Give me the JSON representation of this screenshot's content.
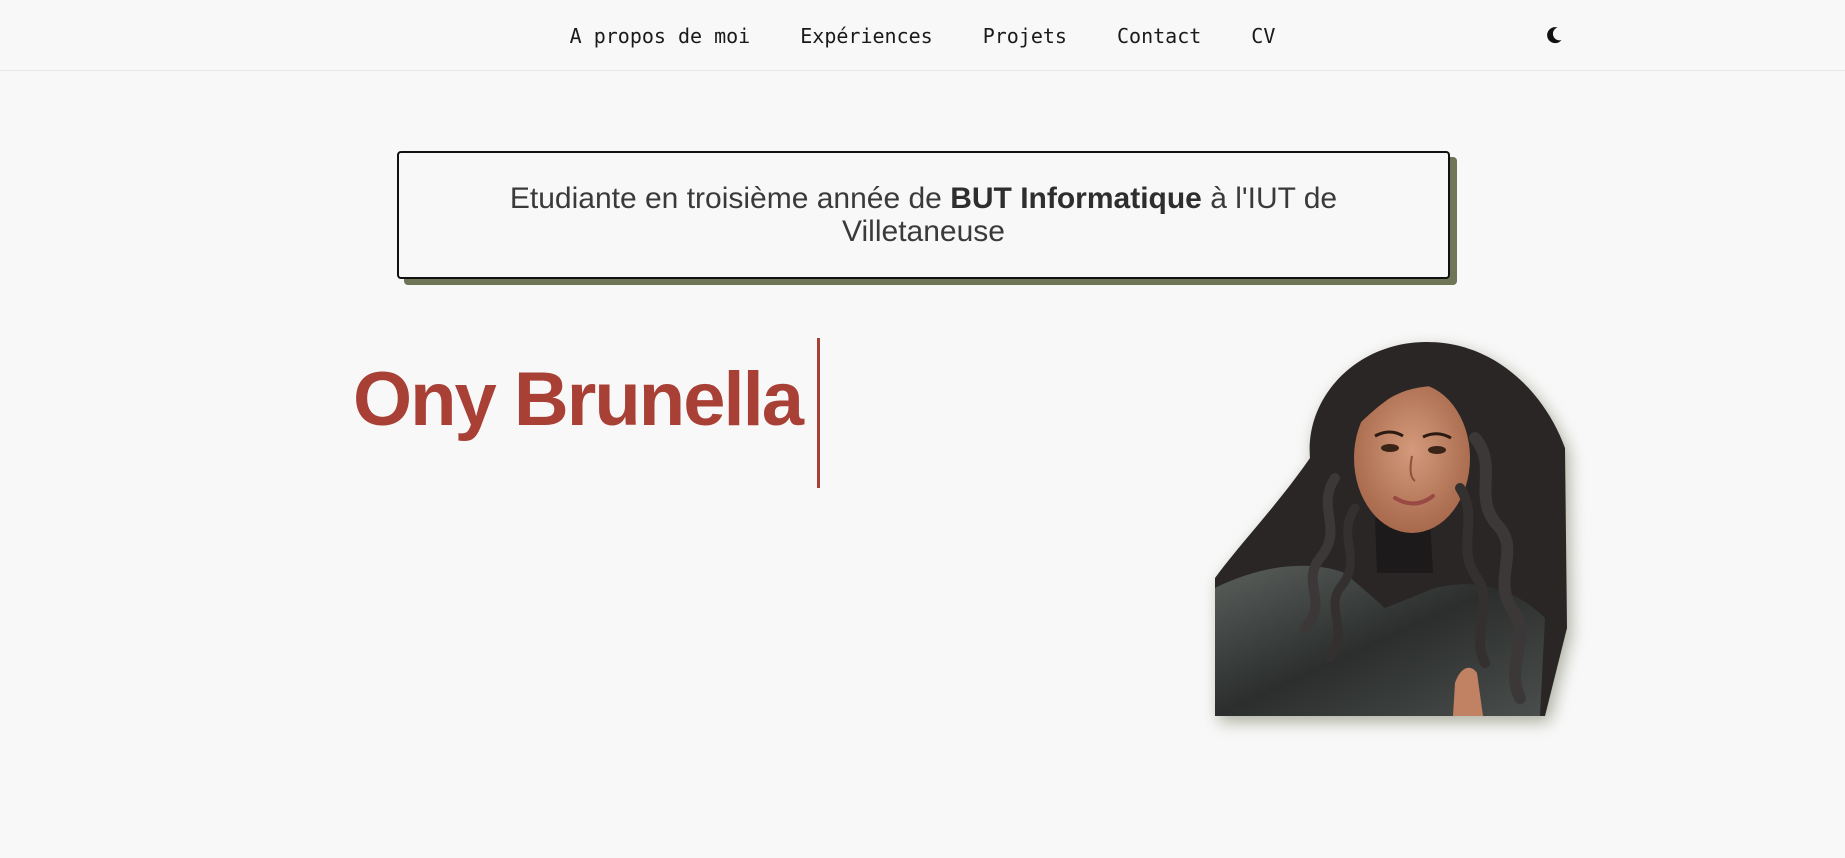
{
  "nav": {
    "links": [
      {
        "label": "A propos de moi"
      },
      {
        "label": "Expériences"
      },
      {
        "label": "Projets"
      },
      {
        "label": "Contact"
      },
      {
        "label": "CV"
      }
    ],
    "theme_toggle_icon": "moon-icon"
  },
  "intro": {
    "text_before": "Etudiante en troisième année de ",
    "text_bold": "BUT Informatique",
    "text_after": " à l'IUT de Villetaneuse"
  },
  "hero": {
    "name": "Ony Brunella"
  },
  "colors": {
    "background": "#f8f8f8",
    "accent": "#a84036",
    "shadow_olive": "#6f7557",
    "text": "#333333"
  }
}
